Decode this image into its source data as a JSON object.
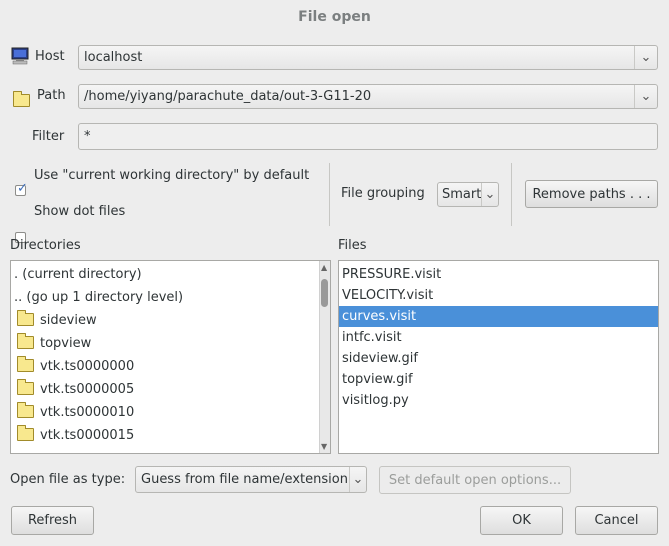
{
  "window": {
    "title": "File open"
  },
  "host": {
    "label": "Host",
    "value": "localhost"
  },
  "path": {
    "label": "Path",
    "value": "/home/yiyang/parachute_data/out-3-G11-20"
  },
  "filter": {
    "label": "Filter",
    "value": "*"
  },
  "options": {
    "use_cwd_label": "Use \"current working directory\" by default",
    "use_cwd_checked": true,
    "show_dot_label": "Show dot files",
    "show_dot_checked": false,
    "file_grouping_label": "File grouping",
    "file_grouping_value": "Smart",
    "remove_paths_label": "Remove paths . . ."
  },
  "directories": {
    "header": "Directories",
    "items": [
      {
        "label": ". (current directory)",
        "icon": ""
      },
      {
        "label": ".. (go up 1 directory level)",
        "icon": ""
      },
      {
        "label": "sideview",
        "icon": "folder-icon"
      },
      {
        "label": "topview",
        "icon": "folder-icon"
      },
      {
        "label": "vtk.ts0000000",
        "icon": "folder-icon"
      },
      {
        "label": "vtk.ts0000005",
        "icon": "folder-icon"
      },
      {
        "label": "vtk.ts0000010",
        "icon": "folder-icon"
      },
      {
        "label": "vtk.ts0000015",
        "icon": "folder-icon"
      }
    ]
  },
  "files": {
    "header": "Files",
    "items": [
      "PRESSURE.visit",
      "VELOCITY.visit",
      "curves.visit",
      "intfc.visit",
      "sideview.gif",
      "topview.gif",
      "visitlog.py"
    ],
    "selected_index": 2
  },
  "open_as": {
    "label": "Open file as type:",
    "value": "Guess from file name/extension",
    "default_options_label": "Set default open options..."
  },
  "buttons": {
    "refresh": "Refresh",
    "ok": "OK",
    "cancel": "Cancel"
  },
  "colors": {
    "selection": "#4a90d9",
    "background": "#ededed"
  }
}
